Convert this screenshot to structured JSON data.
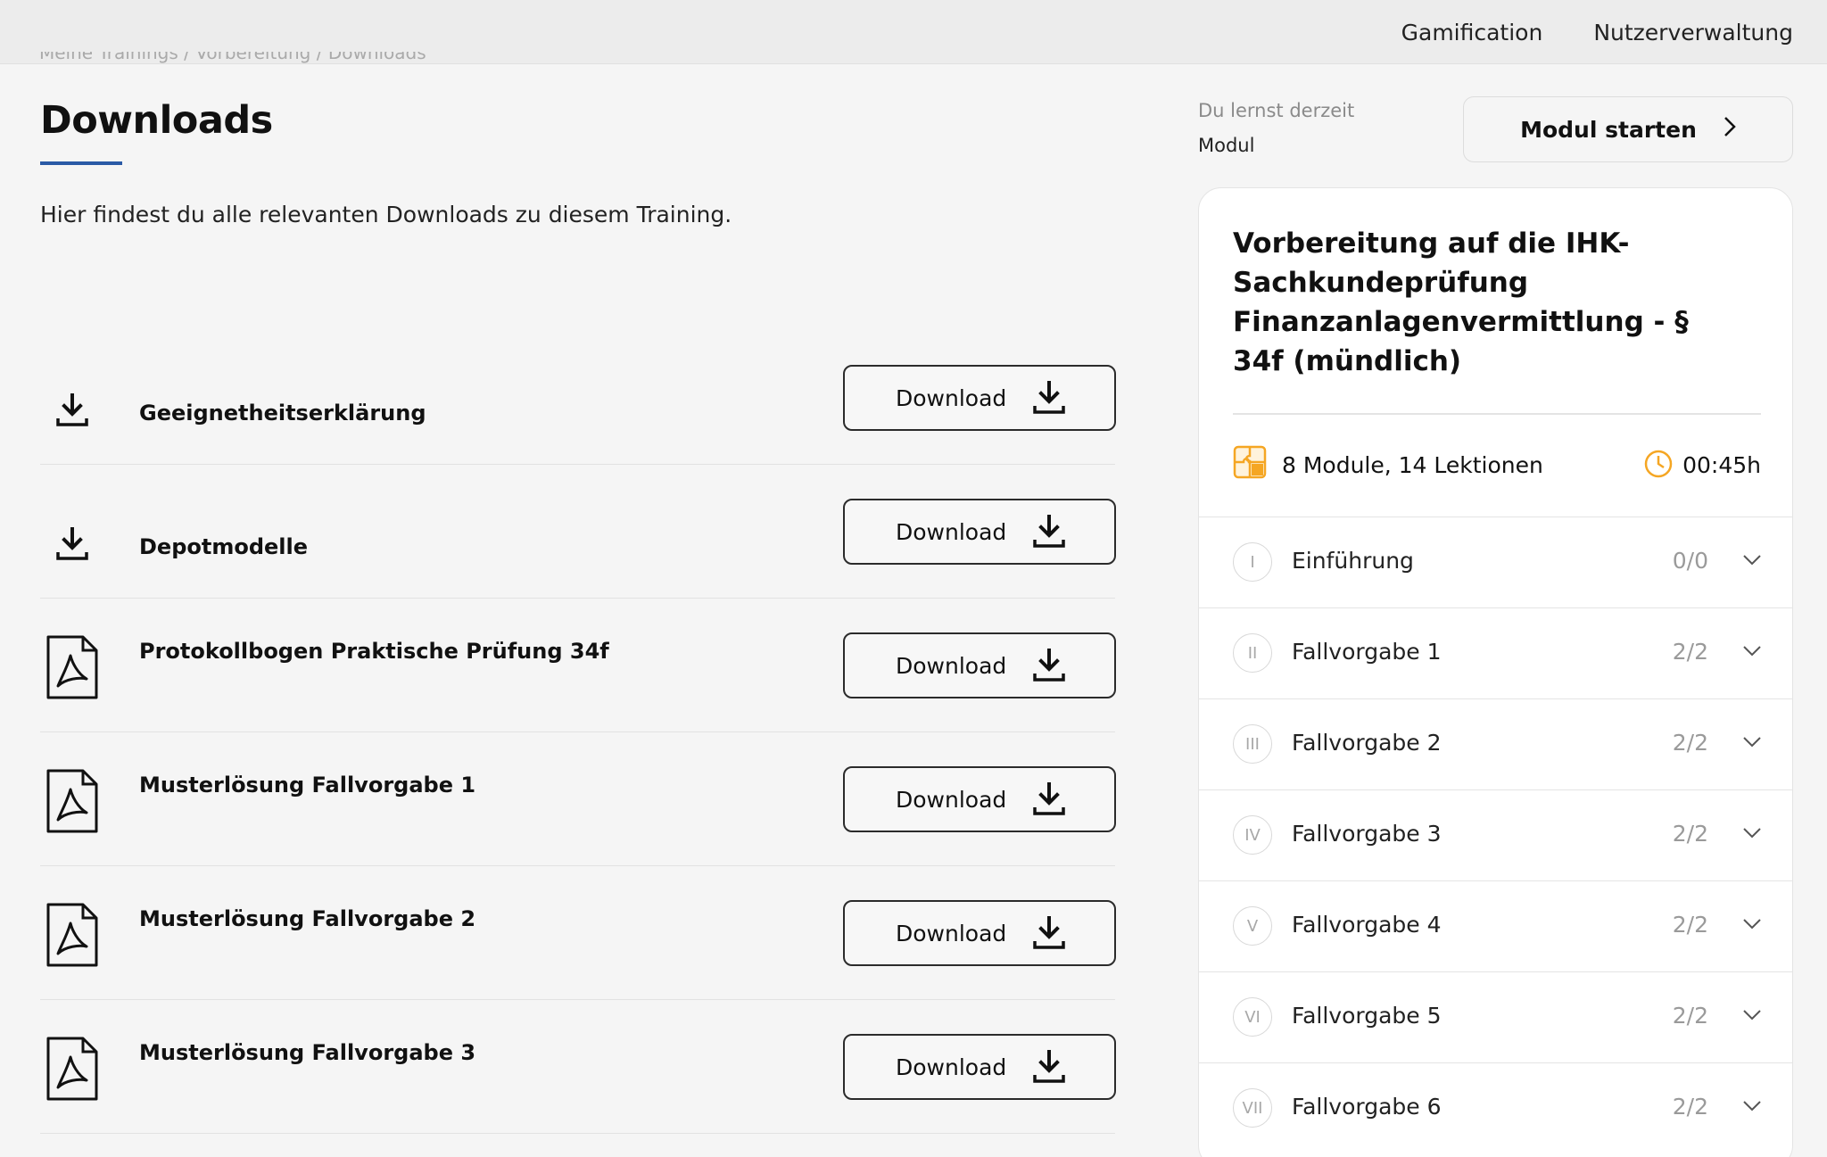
{
  "topnav": {
    "items": [
      "Gamification",
      "Nutzerverwaltung"
    ]
  },
  "breadcrumb": "Meine Trainings / Vorbereitung / Downloads",
  "page": {
    "title": "Downloads",
    "intro": "Hier findest du alle relevanten Downloads zu diesem Training."
  },
  "downloads": {
    "button_label": "Download",
    "items": [
      {
        "name": "Geeignetheitserklärung",
        "icon": "download-icon"
      },
      {
        "name": "Depotmodelle",
        "icon": "download-icon"
      },
      {
        "name": "Protokollbogen Praktische Prüfung 34f",
        "icon": "pdf-icon"
      },
      {
        "name": "Musterlösung Fallvorgabe 1",
        "icon": "pdf-icon"
      },
      {
        "name": "Musterlösung Fallvorgabe 2",
        "icon": "pdf-icon"
      },
      {
        "name": "Musterlösung Fallvorgabe 3",
        "icon": "pdf-icon"
      }
    ]
  },
  "sidebar": {
    "learning_label": "Du lernst derzeit",
    "learning_value": "Modul",
    "start_button": "Modul starten",
    "course": {
      "title": "Vorbereitung auf die IHK-Sachkundeprüfung Finanzanlagenvermittlung - § 34f (mündlich)",
      "summary": "8 Module, 14 Lektionen",
      "duration": "00:45h",
      "accent_color": "#f5a623",
      "modules": [
        {
          "num": "I",
          "name": "Einführung",
          "progress": "0/0"
        },
        {
          "num": "II",
          "name": "Fallvorgabe 1",
          "progress": "2/2"
        },
        {
          "num": "III",
          "name": "Fallvorgabe 2",
          "progress": "2/2"
        },
        {
          "num": "IV",
          "name": "Fallvorgabe 3",
          "progress": "2/2"
        },
        {
          "num": "V",
          "name": "Fallvorgabe 4",
          "progress": "2/2"
        },
        {
          "num": "VI",
          "name": "Fallvorgabe 5",
          "progress": "2/2"
        },
        {
          "num": "VII",
          "name": "Fallvorgabe 6",
          "progress": "2/2"
        }
      ]
    }
  }
}
